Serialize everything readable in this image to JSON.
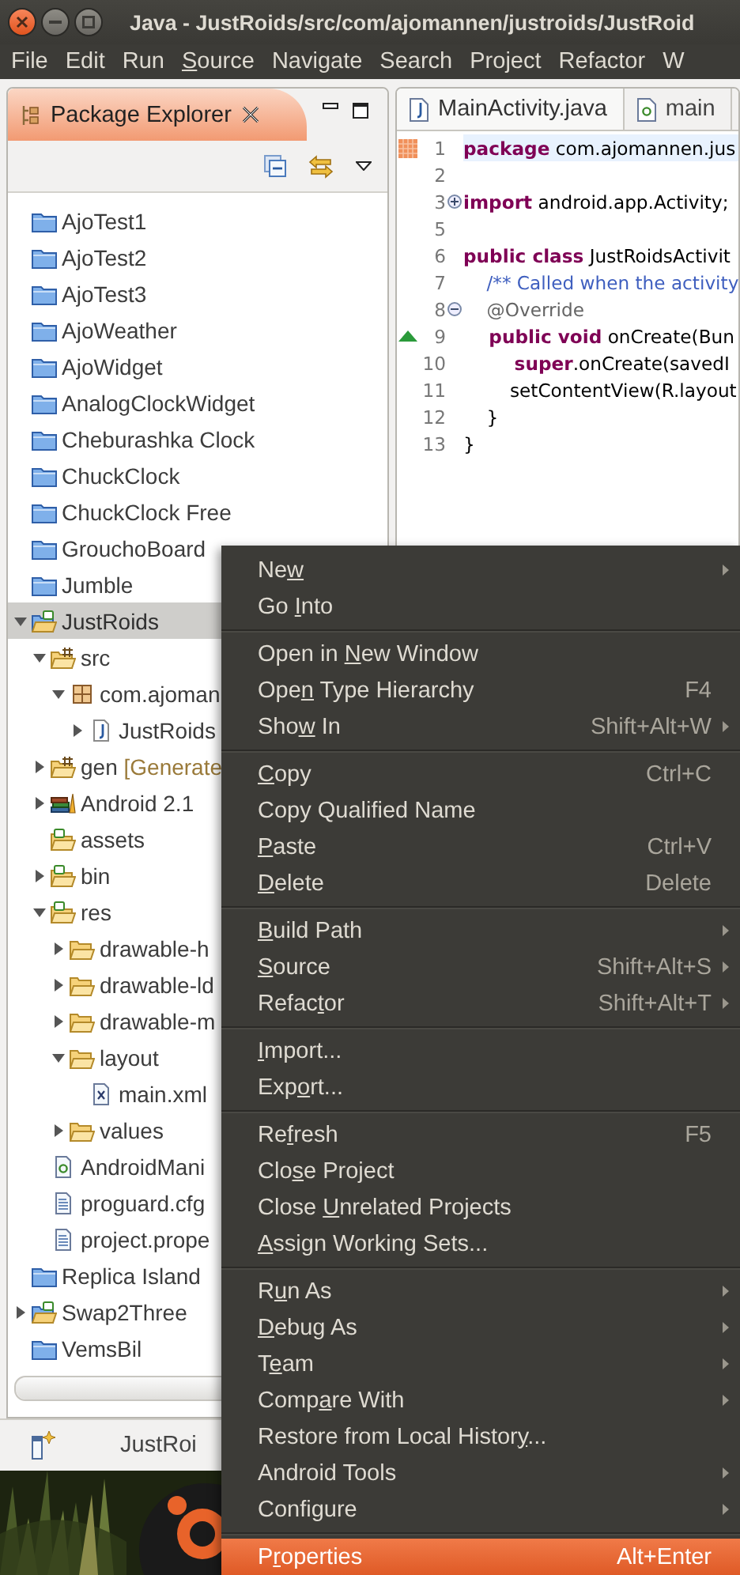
{
  "window": {
    "title": "Java - JustRoids/src/com/ajomannen/justroids/JustRoid"
  },
  "menu_bar": [
    {
      "label": [
        {
          "text": "File",
          "underline": false
        }
      ]
    },
    {
      "label": [
        {
          "text": "Edit",
          "underline": false
        }
      ]
    },
    {
      "label": [
        {
          "text": "Run",
          "underline": false
        }
      ]
    },
    {
      "label": [
        {
          "text": "S",
          "underline": true
        },
        {
          "text": "ource",
          "underline": false
        }
      ]
    },
    {
      "label": [
        {
          "text": "Navigate",
          "underline": false
        }
      ]
    },
    {
      "label": [
        {
          "text": "Search",
          "underline": false
        }
      ]
    },
    {
      "label": [
        {
          "text": "Project",
          "underline": false
        }
      ]
    },
    {
      "label": [
        {
          "text": "Refactor",
          "underline": false
        }
      ]
    },
    {
      "label": [
        {
          "text": "W",
          "underline": false
        }
      ]
    }
  ],
  "package_explorer": {
    "title": "Package Explorer",
    "tree": [
      {
        "label": "AjoTest1",
        "kind": "project",
        "selected": false
      },
      {
        "label": "AjoTest2",
        "kind": "project",
        "selected": false
      },
      {
        "label": "AjoTest3",
        "kind": "project",
        "selected": false
      },
      {
        "label": "AjoWeather",
        "kind": "project",
        "selected": false
      },
      {
        "label": "AjoWidget",
        "kind": "project",
        "selected": false
      },
      {
        "label": "AnalogClockWidget",
        "kind": "project",
        "selected": false
      },
      {
        "label": "Cheburashka Clock",
        "kind": "project",
        "selected": false
      },
      {
        "label": "ChuckClock",
        "kind": "project",
        "selected": false
      },
      {
        "label": "ChuckClock Free",
        "kind": "project",
        "selected": false
      },
      {
        "label": "GrouchoBoard",
        "kind": "project",
        "selected": false
      },
      {
        "label": "Jumble",
        "kind": "project",
        "selected": false
      },
      {
        "label": "JustRoids",
        "kind": "android-project",
        "selected": true,
        "expanded": true,
        "children": [
          {
            "label": "src",
            "kind": "source-folder",
            "selected": false,
            "expanded": true,
            "children": [
              {
                "label": "com.ajoman",
                "kind": "package",
                "selected": false,
                "expanded": true,
                "children": [
                  {
                    "label": "JustRoids",
                    "kind": "java-file",
                    "selected": false,
                    "expanded": false
                  }
                ]
              }
            ]
          },
          {
            "label": "gen",
            "decoration": "[Generate",
            "kind": "source-folder",
            "selected": false,
            "expanded": false
          },
          {
            "label": "Android 2.1",
            "kind": "library",
            "selected": false,
            "expanded": false
          },
          {
            "label": "assets",
            "kind": "android-folder",
            "selected": false
          },
          {
            "label": "bin",
            "kind": "android-folder",
            "selected": false,
            "expanded": false
          },
          {
            "label": "res",
            "kind": "android-folder",
            "selected": false,
            "expanded": true,
            "children": [
              {
                "label": "drawable-h",
                "kind": "folder",
                "selected": false,
                "expanded": false
              },
              {
                "label": "drawable-ld",
                "kind": "folder",
                "selected": false,
                "expanded": false
              },
              {
                "label": "drawable-m",
                "kind": "folder",
                "selected": false,
                "expanded": false
              },
              {
                "label": "layout",
                "kind": "folder",
                "selected": false,
                "expanded": true,
                "children": [
                  {
                    "label": "main.xml",
                    "kind": "xml-file",
                    "selected": false
                  }
                ]
              },
              {
                "label": "values",
                "kind": "folder",
                "selected": false,
                "expanded": false
              }
            ]
          },
          {
            "label": "AndroidMani",
            "kind": "manifest-file",
            "selected": false
          },
          {
            "label": "proguard.cfg",
            "kind": "text-file",
            "selected": false
          },
          {
            "label": "project.prope",
            "kind": "text-file",
            "selected": false
          }
        ]
      },
      {
        "label": "Replica Island",
        "kind": "project",
        "selected": false
      },
      {
        "label": "Swap2Three",
        "kind": "android-project",
        "selected": false,
        "expanded": false
      },
      {
        "label": "VemsBil",
        "kind": "project",
        "selected": false
      }
    ]
  },
  "editor": {
    "tabs": [
      {
        "label": "MainActivity.java",
        "kind": "java",
        "selected": true
      },
      {
        "label": "main",
        "kind": "xml",
        "selected": false
      }
    ],
    "lines": [
      {
        "number": "1",
        "highlighted": true,
        "marker": {
          "kind": "task"
        },
        "tokens": [
          {
            "kind": "keyword",
            "text": "package"
          },
          {
            "kind": "plain",
            "text": " com.ajomannen.jus"
          }
        ]
      },
      {
        "number": "2",
        "highlighted": false
      },
      {
        "number": "3",
        "highlighted": false,
        "fold": {
          "kind": "expand"
        },
        "tokens": [
          {
            "kind": "keyword",
            "text": "import"
          },
          {
            "kind": "plain",
            "text": " android.app.Activity;"
          }
        ]
      },
      {
        "number": "5",
        "highlighted": false
      },
      {
        "number": "6",
        "highlighted": false,
        "tokens": [
          {
            "kind": "keyword",
            "text": "public class"
          },
          {
            "kind": "plain",
            "text": " JustRoidsActivit"
          }
        ]
      },
      {
        "number": "7",
        "highlighted": false,
        "tokens": [
          {
            "kind": "comment",
            "text": "    /** Called when the activity"
          }
        ]
      },
      {
        "number": "8",
        "highlighted": false,
        "fold": {
          "kind": "collapse"
        },
        "tokens": [
          {
            "kind": "annotation",
            "text": "    @Override"
          }
        ]
      },
      {
        "number": "9",
        "highlighted": false,
        "marker": {
          "kind": "override"
        },
        "tokens": [
          {
            "kind": "keyword",
            "text": "    public void"
          },
          {
            "kind": "plain",
            "text": " onCreate(Bun"
          }
        ]
      },
      {
        "number": "10",
        "highlighted": false,
        "tokens": [
          {
            "kind": "keyword",
            "text": "        super"
          },
          {
            "kind": "plain",
            "text": ".onCreate(savedI"
          }
        ]
      },
      {
        "number": "11",
        "highlighted": false,
        "tokens": [
          {
            "kind": "plain",
            "text": "        setContentView(R.layout"
          }
        ]
      },
      {
        "number": "12",
        "highlighted": false,
        "tokens": [
          {
            "kind": "plain",
            "text": "    }"
          }
        ]
      },
      {
        "number": "13",
        "highlighted": false,
        "tokens": [
          {
            "kind": "plain",
            "text": "}"
          }
        ]
      }
    ]
  },
  "status_bar": {
    "text": "JustRoi"
  },
  "context_menu": {
    "items": [
      {
        "kind": "item",
        "label": [
          {
            "text": "Ne",
            "underline": false
          },
          {
            "text": "w",
            "underline": true
          }
        ],
        "submenu": true,
        "selected": false
      },
      {
        "kind": "item",
        "label": [
          {
            "text": "Go ",
            "underline": false
          },
          {
            "text": "I",
            "underline": true
          },
          {
            "text": "nto",
            "underline": false
          }
        ],
        "submenu": false,
        "selected": false
      },
      {
        "kind": "separator"
      },
      {
        "kind": "item",
        "label": [
          {
            "text": "Open in ",
            "underline": false
          },
          {
            "text": "N",
            "underline": true
          },
          {
            "text": "ew Window",
            "underline": false
          }
        ],
        "submenu": false,
        "selected": false
      },
      {
        "kind": "item",
        "label": [
          {
            "text": "Ope",
            "underline": false
          },
          {
            "text": "n",
            "underline": true
          },
          {
            "text": " Type Hierarchy",
            "underline": false
          }
        ],
        "shortcut": "F4",
        "submenu": false,
        "selected": false
      },
      {
        "kind": "item",
        "label": [
          {
            "text": "Sho",
            "underline": false
          },
          {
            "text": "w",
            "underline": true
          },
          {
            "text": " In",
            "underline": false
          }
        ],
        "shortcut": "Shift+Alt+W",
        "submenu": true,
        "selected": false
      },
      {
        "kind": "separator"
      },
      {
        "kind": "item",
        "label": [
          {
            "text": "C",
            "underline": true
          },
          {
            "text": "opy",
            "underline": false
          }
        ],
        "shortcut": "Ctrl+C",
        "submenu": false,
        "selected": false
      },
      {
        "kind": "item",
        "label": [
          {
            "text": "Copy Qualified Name",
            "underline": false
          }
        ],
        "submenu": false,
        "selected": false
      },
      {
        "kind": "item",
        "label": [
          {
            "text": "P",
            "underline": true
          },
          {
            "text": "aste",
            "underline": false
          }
        ],
        "shortcut": "Ctrl+V",
        "submenu": false,
        "selected": false
      },
      {
        "kind": "item",
        "label": [
          {
            "text": "D",
            "underline": true
          },
          {
            "text": "elete",
            "underline": false
          }
        ],
        "shortcut": "Delete",
        "submenu": false,
        "selected": false
      },
      {
        "kind": "separator"
      },
      {
        "kind": "item",
        "label": [
          {
            "text": "B",
            "underline": true
          },
          {
            "text": "uild Path",
            "underline": false
          }
        ],
        "submenu": true,
        "selected": false
      },
      {
        "kind": "item",
        "label": [
          {
            "text": "S",
            "underline": true
          },
          {
            "text": "ource",
            "underline": false
          }
        ],
        "shortcut": "Shift+Alt+S",
        "submenu": true,
        "selected": false
      },
      {
        "kind": "item",
        "label": [
          {
            "text": "Refac",
            "underline": false
          },
          {
            "text": "t",
            "underline": true
          },
          {
            "text": "or",
            "underline": false
          }
        ],
        "shortcut": "Shift+Alt+T",
        "submenu": true,
        "selected": false
      },
      {
        "kind": "separator"
      },
      {
        "kind": "item",
        "label": [
          {
            "text": "I",
            "underline": true
          },
          {
            "text": "mport...",
            "underline": false
          }
        ],
        "submenu": false,
        "selected": false
      },
      {
        "kind": "item",
        "label": [
          {
            "text": "Exp",
            "underline": false
          },
          {
            "text": "o",
            "underline": true
          },
          {
            "text": "rt...",
            "underline": false
          }
        ],
        "submenu": false,
        "selected": false
      },
      {
        "kind": "separator"
      },
      {
        "kind": "item",
        "label": [
          {
            "text": "Re",
            "underline": false
          },
          {
            "text": "f",
            "underline": true
          },
          {
            "text": "resh",
            "underline": false
          }
        ],
        "shortcut": "F5",
        "submenu": false,
        "selected": false
      },
      {
        "kind": "item",
        "label": [
          {
            "text": "Clo",
            "underline": false
          },
          {
            "text": "s",
            "underline": true
          },
          {
            "text": "e Project",
            "underline": false
          }
        ],
        "submenu": false,
        "selected": false
      },
      {
        "kind": "item",
        "label": [
          {
            "text": "Close ",
            "underline": false
          },
          {
            "text": "U",
            "underline": true
          },
          {
            "text": "nrelated Projects",
            "underline": false
          }
        ],
        "submenu": false,
        "selected": false
      },
      {
        "kind": "item",
        "label": [
          {
            "text": "A",
            "underline": true
          },
          {
            "text": "ssign Working Sets...",
            "underline": false
          }
        ],
        "submenu": false,
        "selected": false
      },
      {
        "kind": "separator"
      },
      {
        "kind": "item",
        "label": [
          {
            "text": "R",
            "underline": false
          },
          {
            "text": "u",
            "underline": true
          },
          {
            "text": "n As",
            "underline": false
          }
        ],
        "submenu": true,
        "selected": false
      },
      {
        "kind": "item",
        "label": [
          {
            "text": "D",
            "underline": true
          },
          {
            "text": "ebug As",
            "underline": false
          }
        ],
        "submenu": true,
        "selected": false
      },
      {
        "kind": "item",
        "label": [
          {
            "text": "T",
            "underline": false
          },
          {
            "text": "e",
            "underline": true
          },
          {
            "text": "am",
            "underline": false
          }
        ],
        "submenu": true,
        "selected": false
      },
      {
        "kind": "item",
        "label": [
          {
            "text": "Comp",
            "underline": false
          },
          {
            "text": "a",
            "underline": true
          },
          {
            "text": "re With",
            "underline": false
          }
        ],
        "submenu": true,
        "selected": false
      },
      {
        "kind": "item",
        "label": [
          {
            "text": "Restore from Local Histor",
            "underline": false
          },
          {
            "text": "y",
            "underline": true
          },
          {
            "text": "...",
            "underline": false
          }
        ],
        "submenu": false,
        "selected": false
      },
      {
        "kind": "item",
        "label": [
          {
            "text": "Android Tools",
            "underline": false
          }
        ],
        "submenu": true,
        "selected": false
      },
      {
        "kind": "item",
        "label": [
          {
            "text": "Configure",
            "underline": false
          }
        ],
        "submenu": true,
        "selected": false
      },
      {
        "kind": "separator"
      },
      {
        "kind": "item",
        "label": [
          {
            "text": "P",
            "underline": false
          },
          {
            "text": "r",
            "underline": true
          },
          {
            "text": "operties",
            "underline": false
          }
        ],
        "shortcut": "Alt+Enter",
        "submenu": false,
        "selected": true
      }
    ]
  }
}
